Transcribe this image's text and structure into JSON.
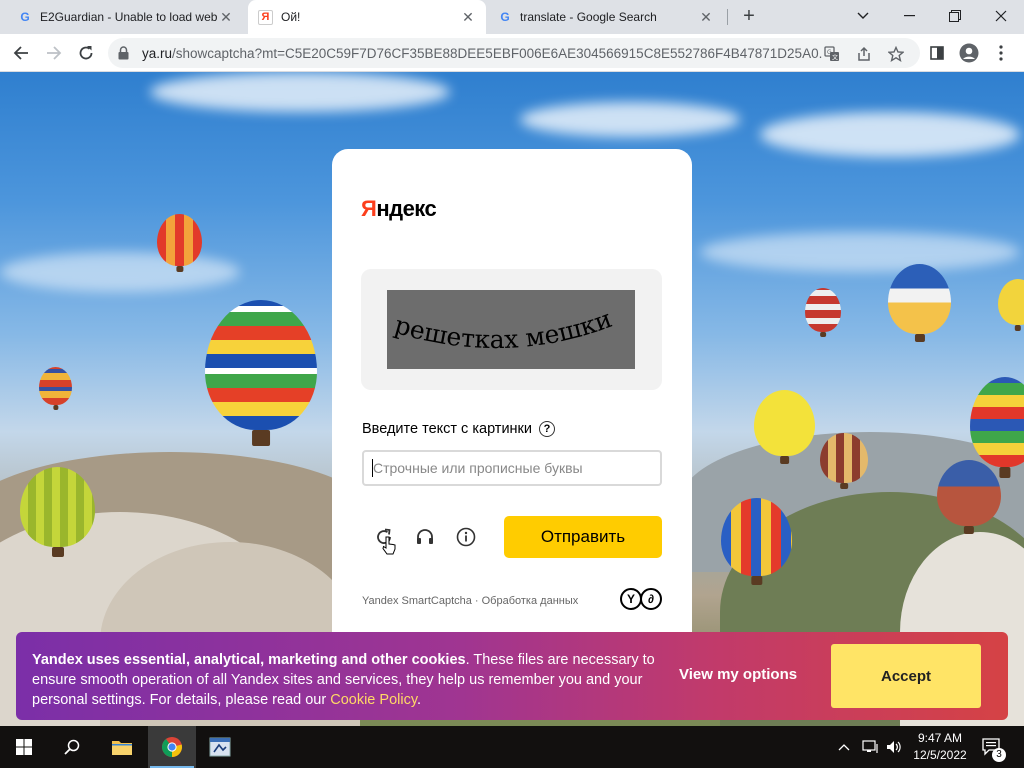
{
  "browser": {
    "tabs": [
      {
        "title": "E2Guardian - Unable to load web",
        "favicon": "google-g-icon",
        "active": false
      },
      {
        "title": "Ой!",
        "favicon": "yandex-icon",
        "active": true
      },
      {
        "title": "translate - Google Search",
        "favicon": "google-g-icon",
        "active": false
      }
    ],
    "new_tab": "+",
    "url_host": "ya.ru",
    "url_path": "/showcaptcha?mt=C5E20C59F7D76CF35BE88DEE5EBF006E6AE304566915C8E552786F4B47871D25A0..."
  },
  "captcha": {
    "logo_first": "Я",
    "logo_rest": "ндекс",
    "captcha_words": "решетках мешки",
    "prompt": "Введите текст с картинки",
    "help": "?",
    "placeholder": "Строчные или прописные буквы",
    "submit": "Отправить",
    "footer": "Yandex SmartCaptcha · Обработка данных",
    "badges": [
      "Y",
      "∂"
    ]
  },
  "cookie": {
    "lead": "Yandex uses essential, analytical, marketing and other cookies",
    "body": ". These files are necessary to ensure smooth operation of all Yandex sites and services, they help us remember you and your personal settings. For details, please read our ",
    "link": "Cookie Policy",
    "end": ".",
    "view_options": "View my options",
    "accept": "Accept"
  },
  "taskbar": {
    "time": "9:47 AM",
    "date": "12/5/2022",
    "notification_count": "3"
  },
  "colors": {
    "yandex_red": "#fc3f1d",
    "submit_yellow": "#ffcc00",
    "accept_yellow": "#ffe466"
  }
}
